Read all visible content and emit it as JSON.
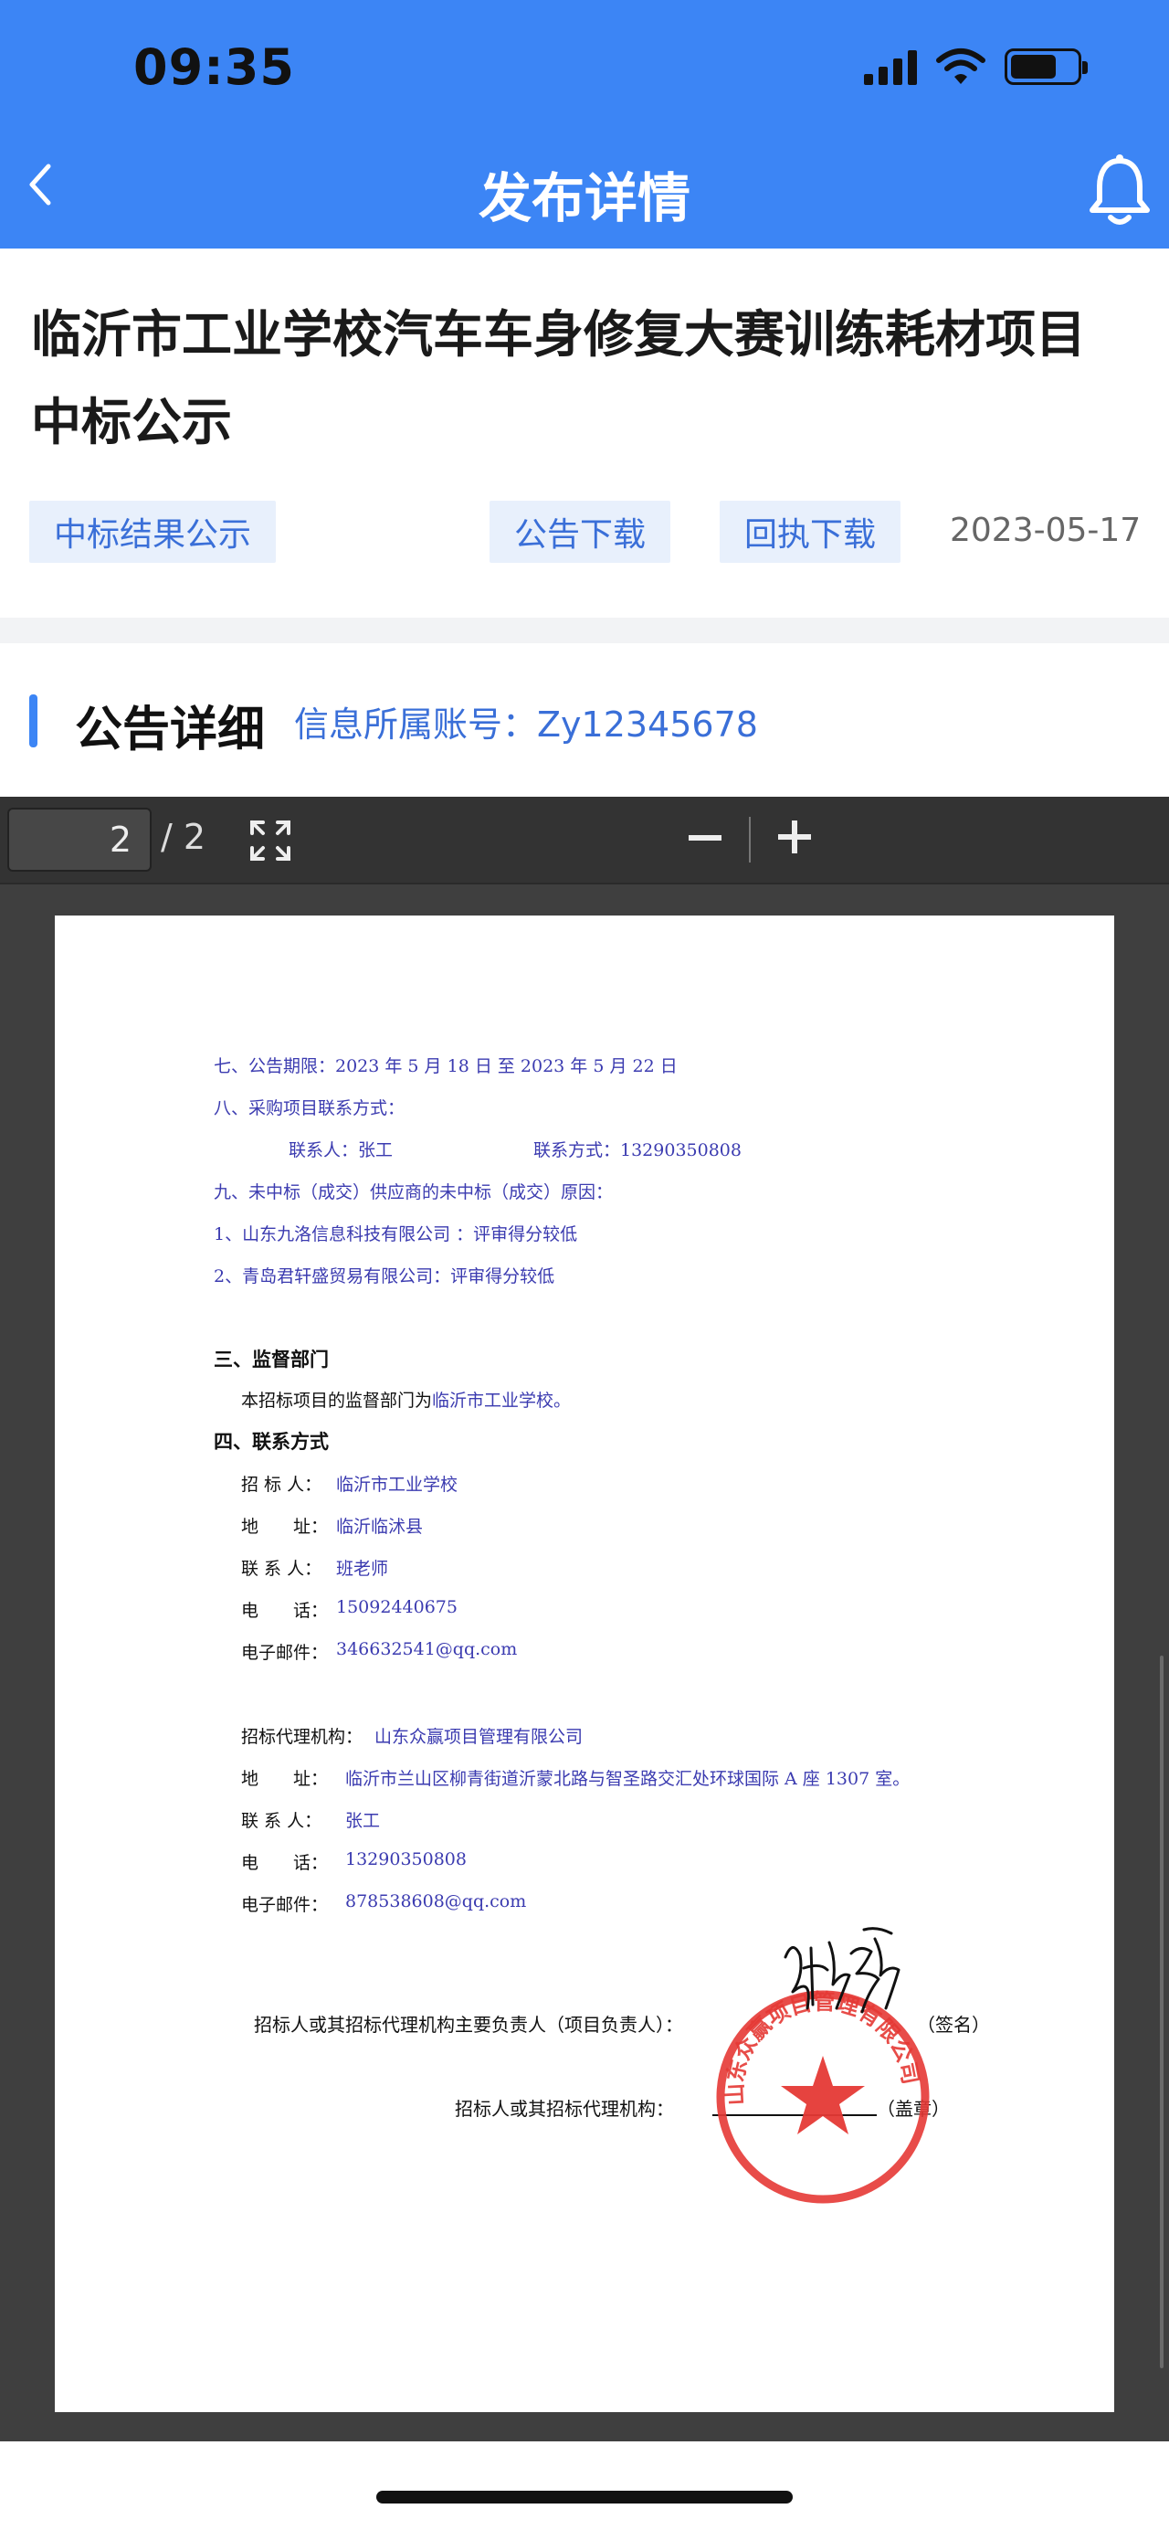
{
  "status_bar": {
    "time": "09:35"
  },
  "nav": {
    "title": "发布详情"
  },
  "article": {
    "title": "临沂市工业学校汽车车身修复大赛训练耗材项目中标公示",
    "tags": [
      "中标结果公示",
      "公告下载",
      "回执下载"
    ],
    "date": "2023-05-17"
  },
  "section": {
    "title": "公告详细",
    "account": "信息所属账号：Zy12345678"
  },
  "pdf_toolbar": {
    "current_page": "2",
    "total_pages": "/ 2"
  },
  "pdf": {
    "lines": [
      "七、公告期限：2023 年 5 月 18 日 至 2023 年 5 月 22 日",
      "八、采购项目联系方式：",
      "联系人：张工",
      "联系方式：13290350808",
      "九、未中标（成交）供应商的未中标（成交）原因：",
      "1、山东九洛信息科技有限公司 ：评审得分较低",
      "2、青岛君轩盛贸易有限公司：评审得分较低"
    ],
    "supervision": {
      "heading": "三、监督部门",
      "text_prefix": "本招标项目的监督部门为",
      "text_value": "临沂市工业学校。"
    },
    "contact": {
      "heading": "四、联系方式",
      "tenderer": {
        "label": "招 标 人：",
        "value": "临沂市工业学校"
      },
      "address": {
        "label": "地　　址：",
        "value": "临沂临沭县"
      },
      "person": {
        "label": "联 系 人：",
        "value": "班老师"
      },
      "phone": {
        "label": "电　　话：",
        "value": "15092440675"
      },
      "email": {
        "label": "电子邮件：",
        "value": "346632541@qq.com"
      }
    },
    "agency": {
      "name_label": "招标代理机构：",
      "name_value": "山东众赢项目管理有限公司",
      "address_label": "地　　址：",
      "address_value": "临沂市兰山区柳青街道沂蒙北路与智圣路交汇处环球国际 A 座 1307 室。",
      "person_label": "联 系 人：",
      "person_value": "张工",
      "phone_label": "电　　话：",
      "phone_value": "13290350808",
      "email_label": "电子邮件：",
      "email_value": "878538608@qq.com"
    },
    "signature": {
      "line1_label": "招标人或其招标代理机构主要负责人（项目负责人）：",
      "line1_suffix": "（签名）",
      "line2_label": "招标人或其招标代理机构：",
      "line2_suffix": "（盖章）"
    },
    "stamp_text": "山东众赢项目管理有限公司"
  },
  "colors": {
    "header_blue": "#3c85f5",
    "link_blue": "#3a6fd8",
    "pdf_text_blue": "#3b3bb0",
    "stamp_red": "#e53935"
  }
}
